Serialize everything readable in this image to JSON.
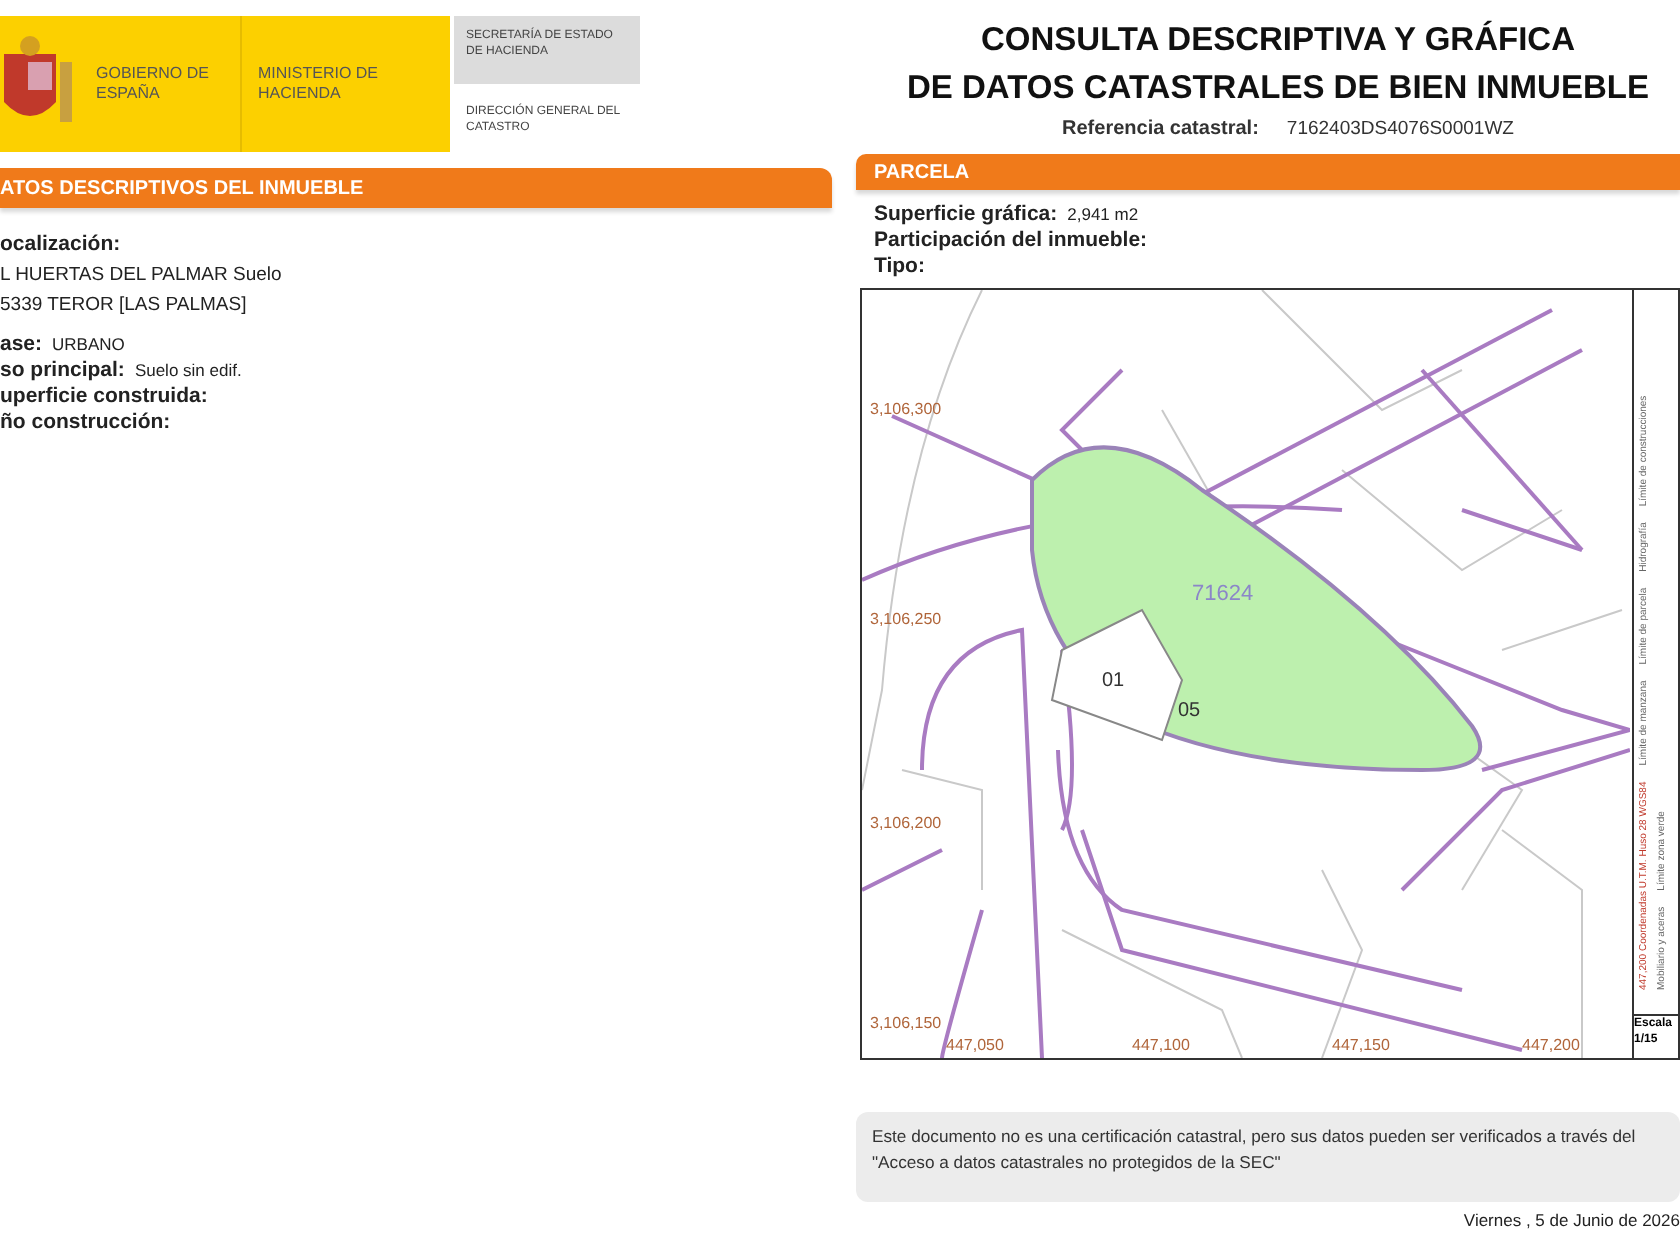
{
  "header": {
    "government": "GOBIERNO DE ESPAÑA",
    "ministry": "MINISTERIO DE HACIENDA",
    "secretariat": "SECRETARÍA DE ESTADO DE HACIENDA",
    "directorate": "DIRECCIÓN GENERAL DEL CATASTRO"
  },
  "title_lines": [
    "CONSULTA DESCRIPTIVA Y GRÁFICA",
    "DE DATOS CATASTRALES DE BIEN INMUEBLE"
  ],
  "reference": {
    "label": "Referencia catastral:",
    "value": "7162403DS4076S0001WZ"
  },
  "property_section": {
    "heading": "ATOS DESCRIPTIVOS DEL INMUEBLE",
    "fields": [
      {
        "label": "ocalización:",
        "value_lines": [
          "L HUERTAS DEL PALMAR  Suelo",
          "5339 TEROR [LAS PALMAS]"
        ]
      },
      {
        "label": "ase:",
        "value": "URBANO"
      },
      {
        "label": "so principal:",
        "value": "Suelo sin edif."
      },
      {
        "label": "uperficie construida:"
      },
      {
        "label": "ño construcción:"
      }
    ]
  },
  "parcel_section": {
    "heading": "PARCELA",
    "fields": [
      {
        "label": "Superficie gráfica:",
        "value": "2,941 m2"
      },
      {
        "label": "Participación del inmueble:"
      },
      {
        "label": "Tipo:"
      }
    ]
  },
  "map": {
    "y_ticks": [
      "3,106,300",
      "3,106,250",
      "3,106,200",
      "3,106,150"
    ],
    "x_ticks": [
      "447,050",
      "447,100",
      "447,150",
      "447,200"
    ],
    "parcel_labels": [
      {
        "kind": "block",
        "text": "71624"
      },
      {
        "kind": "plot",
        "text": "01"
      },
      {
        "kind": "plot",
        "text": "05"
      }
    ],
    "legend": [
      "Límite de manzana",
      "Límite de parcela",
      "Hidrografía",
      "Límite de construcciones",
      "Mobiliario y aceras",
      "Límite zona verde"
    ],
    "coordinates_note": "447,200 Coordenadas U.T.M. Huso 28 WGS84",
    "scale_label": "Escala",
    "scale_value": "1/15"
  },
  "footer_note": "Este documento no es una certificación catastral, pero sus datos pueden ser verificados a través del \"Acceso a datos catastrales no protegidos de la SEC\"",
  "date": "Viernes , 5 de Junio de 2026"
}
